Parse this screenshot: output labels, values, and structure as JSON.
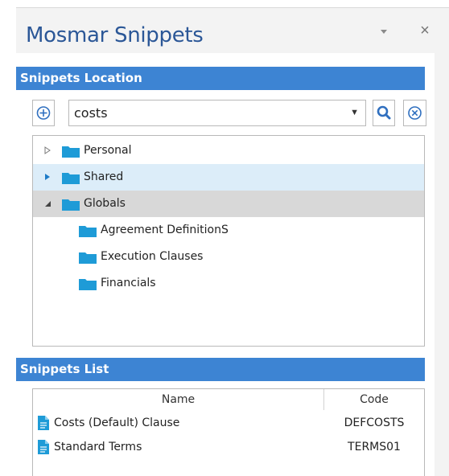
{
  "pane": {
    "title": "Mosmar Snippets",
    "dropdown_icon": "triangle-down-icon",
    "close_glyph": "×"
  },
  "location": {
    "header": "Snippets Location",
    "search_value": "costs",
    "combo_arrow": "▼"
  },
  "tree": {
    "items": [
      {
        "label": "Personal",
        "state": "collapsed"
      },
      {
        "label": "Shared",
        "state": "collapsed-hover"
      },
      {
        "label": "Globals",
        "state": "expanded-selected"
      },
      {
        "label": "Agreement DefinitionS"
      },
      {
        "label": "Execution Clauses"
      },
      {
        "label": "Financials"
      }
    ]
  },
  "list": {
    "header": "Snippets List",
    "columns": [
      "Name",
      "Code"
    ],
    "rows": [
      {
        "name": "Costs (Default) Clause",
        "code": "DEFCOSTS"
      },
      {
        "name": "Standard Terms",
        "code": "TERMS01"
      }
    ]
  },
  "colors": {
    "accent": "#3d84d3",
    "title": "#2b5797",
    "folder": "#1e9bd7",
    "hover_row": "#dcedf9",
    "selected_row": "#d8d8d8"
  }
}
